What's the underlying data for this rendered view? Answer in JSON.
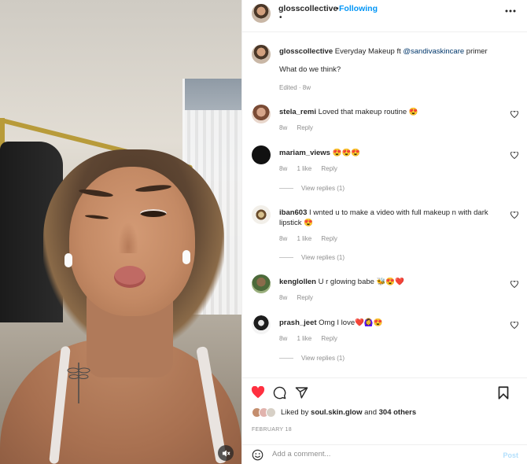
{
  "post": {
    "username": "glosscollective",
    "separator": "•",
    "follow_state": "Following",
    "subline": "•",
    "caption_user": "glosscollective",
    "caption_text": "Everyday Makeup ft ",
    "caption_mention": "@sandivaskincare",
    "caption_tail": " primer",
    "caption_question": "What do we think?",
    "caption_meta": "Edited · 8w"
  },
  "comments": [
    {
      "user": "stela_remi",
      "text": "Loved that makeup routine 😍",
      "time": "8w",
      "likes": "",
      "reply": "Reply",
      "view_replies": ""
    },
    {
      "user": "mariam_views",
      "text": "😍😍😍",
      "time": "8w",
      "likes": "1 like",
      "reply": "Reply",
      "view_replies": "View replies (1)"
    },
    {
      "user": "iban603",
      "text": "I wnted u to make a video with full makeup n with dark lipstick 😍",
      "time": "8w",
      "likes": "1 like",
      "reply": "Reply",
      "view_replies": "View replies (1)"
    },
    {
      "user": "kenglollen",
      "text": "U r glowing babe 🐝😍❤️",
      "time": "8w",
      "likes": "",
      "reply": "Reply",
      "view_replies": ""
    },
    {
      "user": "prash_jeet",
      "text": "Omg I love❤️🙆‍♀️😍",
      "time": "8w",
      "likes": "1 like",
      "reply": "Reply",
      "view_replies": "View replies (1)"
    }
  ],
  "footer": {
    "liked_by_prefix": "Liked by ",
    "liked_by_user": "soul.skin.glow",
    "liked_by_and": " and ",
    "liked_by_others": "304 others",
    "date": "FEBRUARY 18",
    "comment_placeholder": "Add a comment...",
    "post_label": "Post"
  },
  "icons": {
    "like": "heart-filled-icon",
    "comment": "comment-bubble-icon",
    "share": "paper-plane-icon",
    "save": "bookmark-icon",
    "more": "more-horizontal-icon",
    "mute": "speaker-muted-icon",
    "emoji": "emoji-icon"
  },
  "colors": {
    "like_red": "#ff3040",
    "link_blue": "#0095f6",
    "mention": "#00376b",
    "muted_text": "#8e8e8e",
    "post_disabled": "#b2dffc"
  }
}
